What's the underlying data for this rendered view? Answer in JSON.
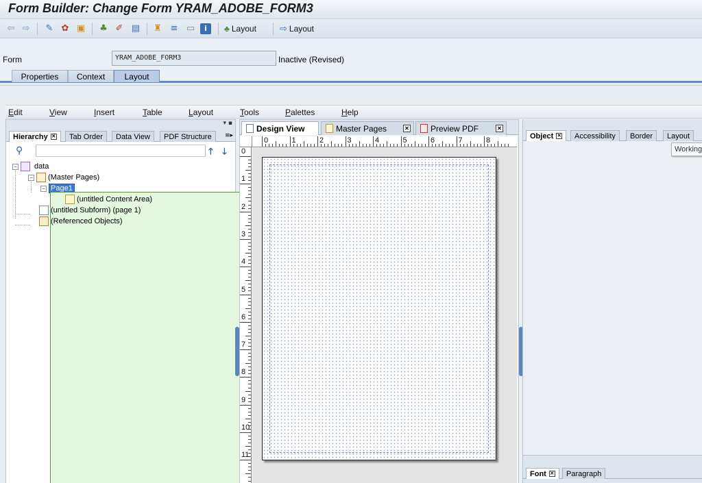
{
  "window": {
    "title": "Form Builder: Change Form YRAM_ADOBE_FORM3"
  },
  "toolbar": {
    "icons": [
      "back-icon",
      "forward-icon",
      "edit-toggle-icon",
      "check-icon",
      "activate-icon",
      "object-list-icon",
      "pencil-icon",
      "print-icon",
      "hierarchy-icon",
      "align-icon",
      "window-icon",
      "info-icon"
    ],
    "layout_btn1": "Layout",
    "layout_btn2": "Layout"
  },
  "form": {
    "label": "Form",
    "value": "YRAM_ADOBE_FORM3",
    "status": "Inactive (Revised)"
  },
  "main_tabs": [
    {
      "label": "Properties"
    },
    {
      "label": "Context"
    },
    {
      "label": "Layout"
    }
  ],
  "menu": {
    "items": [
      {
        "accel": "E",
        "rest": "dit"
      },
      {
        "accel": "V",
        "rest": "iew"
      },
      {
        "accel": "I",
        "rest": "nsert"
      },
      {
        "accel": "T",
        "rest": "able"
      },
      {
        "accel": "L",
        "rest": "ayout"
      },
      {
        "accel": "T",
        "rest": "ools"
      },
      {
        "accel": "P",
        "rest": "alettes"
      },
      {
        "accel": "H",
        "rest": "elp"
      }
    ]
  },
  "left_palette": {
    "tabs": [
      {
        "label": "Hierarchy"
      },
      {
        "label": "Tab Order"
      },
      {
        "label": "Data View"
      },
      {
        "label": "PDF Structure"
      }
    ],
    "tree": {
      "data": "data",
      "master_pages": "(Master Pages)",
      "page1": "Page1",
      "content_area": "(untitled Content Area)",
      "subform": "(untitled Subform) (page 1)",
      "referenced": "(Referenced Objects)"
    }
  },
  "center": {
    "tabs": [
      {
        "label": "Design View"
      },
      {
        "label": "Master Pages"
      },
      {
        "label": "Preview PDF"
      }
    ],
    "h_ruler": [
      "0",
      "1",
      "2",
      "3",
      "4",
      "5",
      "6",
      "7",
      "8"
    ],
    "v_ruler": [
      "0",
      "1",
      "2",
      "3",
      "4",
      "5",
      "6",
      "7",
      "8",
      "9",
      "10",
      "11"
    ]
  },
  "right_palette": {
    "tabs": [
      {
        "label": "Object"
      },
      {
        "label": "Accessibility"
      },
      {
        "label": "Border"
      },
      {
        "label": "Layout"
      }
    ],
    "tooltip": "Working",
    "bottom_tabs": [
      {
        "label": "Font"
      },
      {
        "label": "Paragraph"
      }
    ]
  }
}
